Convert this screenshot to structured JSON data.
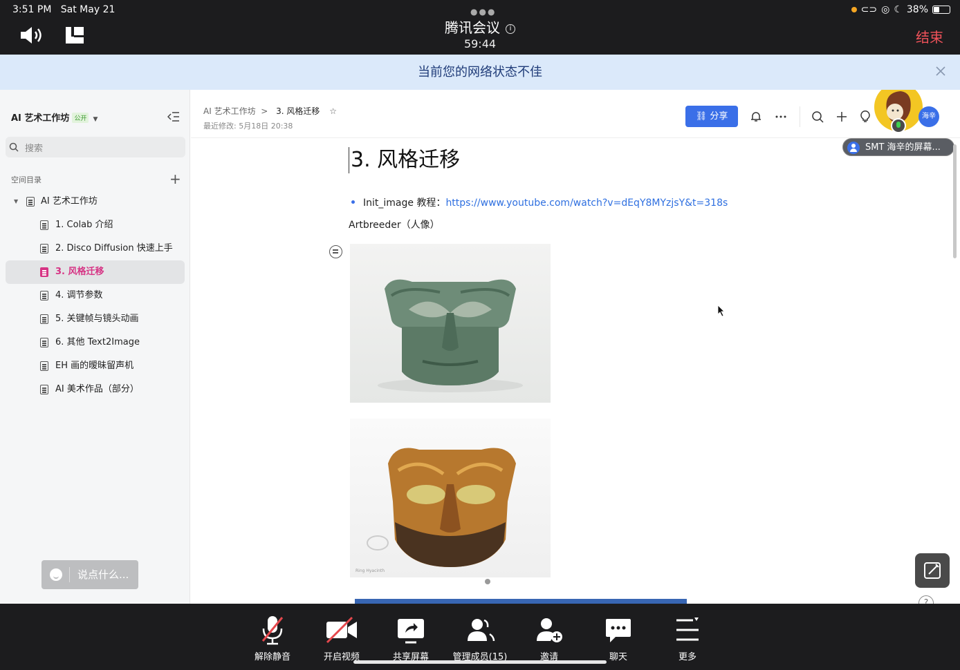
{
  "status": {
    "time": "3:51 PM",
    "date": "Sat May 21",
    "battery": "38%"
  },
  "meeting": {
    "title": "腾讯会议",
    "timer": "59:44",
    "end_label": "结束"
  },
  "banner": {
    "text": "当前您的网络状态不佳"
  },
  "sidebar": {
    "workspace": "AI 艺术工作坊",
    "workspace_badge": "公开",
    "search_placeholder": "搜索",
    "dir_label": "空间目录",
    "root": "AI 艺术工作坊",
    "items": [
      {
        "label": "1. Colab 介绍"
      },
      {
        "label": "2. Disco Diffusion 快速上手"
      },
      {
        "label": "3. 风格迁移"
      },
      {
        "label": "4. 调节参数"
      },
      {
        "label": "5. 关键帧与镜头动画"
      },
      {
        "label": "6. 其他 Text2Image"
      },
      {
        "label": "EH 画的暧昧留声机"
      },
      {
        "label": "AI 美术作品（部分）"
      }
    ],
    "say_placeholder": "说点什么..."
  },
  "doc": {
    "breadcrumb_parent": "AI 艺术工作坊",
    "breadcrumb_sep": ">",
    "breadcrumb_current": "3. 风格迁移",
    "last_modified": "最近修改: 5月18日 20:38",
    "share_label": "分享",
    "small_avatar_label": "海辛",
    "screen_share_label": "SMT 海辛的屏幕...",
    "title": "3. 风格迁移",
    "bullet_prefix": "Init_image 教程：",
    "bullet_link": "https://www.youtube.com/watch?v=dEqY8MYzjsY&t=318s",
    "paragraph": "Artbreeder（人像）",
    "image2_caption": "Ring Hyacinth"
  },
  "toolbar": {
    "unmute": "解除静音",
    "video": "开启视频",
    "share_screen": "共享屏幕",
    "members": "管理成员(15)",
    "invite": "邀请",
    "chat": "聊天",
    "more": "更多"
  },
  "colors": {
    "accent": "#3a6fe8",
    "active_item": "#d63384",
    "end": "#f0525a",
    "banner_bg": "#dbe9fa"
  }
}
